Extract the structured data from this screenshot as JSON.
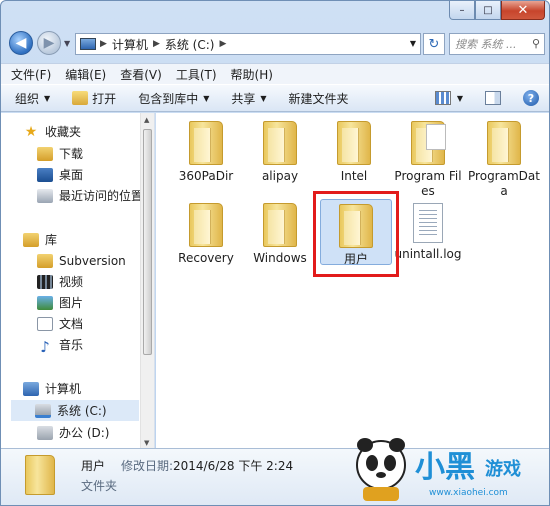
{
  "window": {
    "minimize": "–",
    "maximize": "□",
    "close": "✕"
  },
  "address": {
    "seg1": "计算机",
    "seg2": "系统 (C:)",
    "search_placeholder": "搜索 系统 ..."
  },
  "menu": [
    "文件(F)",
    "编辑(E)",
    "查看(V)",
    "工具(T)",
    "帮助(H)"
  ],
  "commands": {
    "organize": "组织",
    "open": "打开",
    "include": "包含到库中",
    "share": "共享",
    "newfolder": "新建文件夹"
  },
  "nav": {
    "favorites": "收藏夹",
    "downloads": "下载",
    "desktop": "桌面",
    "recent": "最近访问的位置",
    "libraries": "库",
    "subversion": "Subversion",
    "videos": "视频",
    "pictures": "图片",
    "documents": "文档",
    "music": "音乐",
    "computer": "计算机",
    "drive_c": "系统 (C:)",
    "drive_d": "办公 (D:)"
  },
  "items": [
    {
      "label": "360PaDir"
    },
    {
      "label": "alipay"
    },
    {
      "label": "Intel"
    },
    {
      "label": "Program Files"
    },
    {
      "label": "ProgramData"
    },
    {
      "label": "Recovery"
    },
    {
      "label": "Windows"
    },
    {
      "label": "用户"
    },
    {
      "label": "unintall.log"
    }
  ],
  "details": {
    "name": "用户",
    "modified_label": "修改日期:",
    "modified_value": "2014/6/28 下午 2:24",
    "type": "文件夹"
  },
  "watermark": {
    "url": "www.xiaohei.com"
  },
  "colors": {
    "highlight_box": "#e21b1b",
    "selection": "#cfe1f7"
  }
}
